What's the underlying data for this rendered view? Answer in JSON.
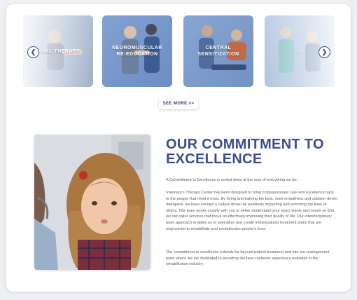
{
  "carousel": {
    "slides": [
      {
        "label": "...UAL THERAPY",
        "bg_color": "#7d93b3"
      },
      {
        "label": "NEUROMUSCULAR\nRE-EDUCATION",
        "bg_color": "#6f8ec2"
      },
      {
        "label": "CENTRAL\nSENSITIZATION",
        "bg_color": "#6f90c4"
      },
      {
        "label": "...",
        "bg_color": "#8aa6cc"
      }
    ],
    "prev_icon": "chevron-left-icon",
    "next_icon": "chevron-right-icon",
    "prev_glyph": "❮",
    "next_glyph": "❯",
    "see_more_label": "SEE MORE >>"
  },
  "section": {
    "heading": "OUR COMMITMENT TO EXCELLENCE",
    "paragraphs": [
      "A Commitment to Excellence is rooted deep at the core of everything we do.",
      "Visionary's Therapy Center has been designed to bring compassionate care and excellence back to the people that need it most. By hiring and training the best, most empathetic and solution-driven therapists, we have created a culture driven by positively impacting and enriching the lives of others. Our team works closely with you to better understand your exact wants and needs so that we can tailor services that focus on effectively improving their quality of life. Our interdisciplinary team approach enables us to specialize and create individualized treatment plans that are engineered to rehabilitate and revolutionize people's lives.",
      "Our commitment to excellence extends far beyond patient treatment and into our management team where we are dedicated to providing the best customer experience available in the rehabilitation industry."
    ]
  },
  "colors": {
    "accent": "#3a4d94",
    "slide_tint": "#6f8ec2",
    "text": "#555a63"
  }
}
